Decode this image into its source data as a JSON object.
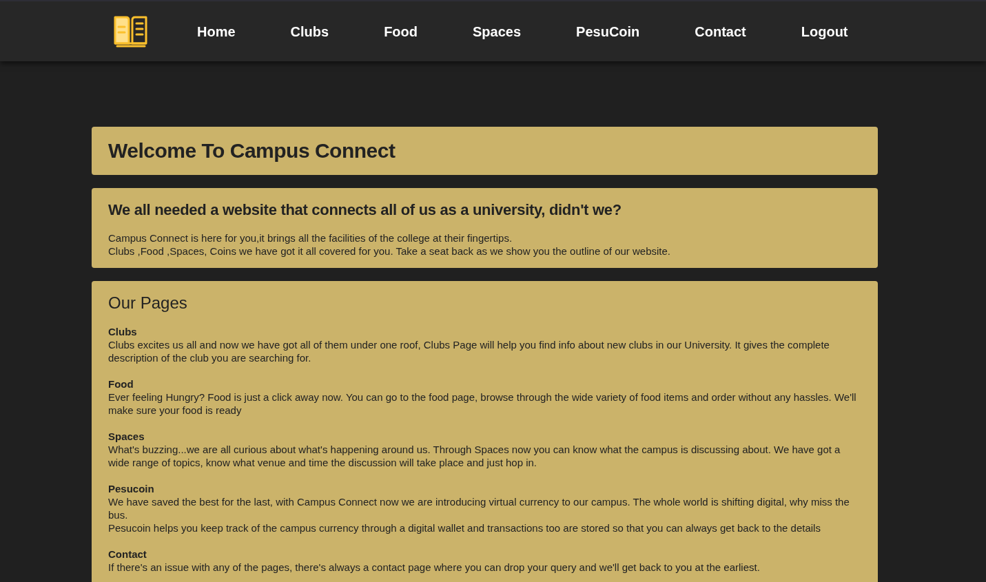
{
  "nav": {
    "items": [
      {
        "label": "Home"
      },
      {
        "label": "Clubs"
      },
      {
        "label": "Food"
      },
      {
        "label": "Spaces"
      },
      {
        "label": "PesuCoin"
      },
      {
        "label": "Contact"
      },
      {
        "label": "Logout"
      }
    ]
  },
  "welcome": {
    "title": "Welcome To Campus Connect"
  },
  "intro": {
    "heading": "We all needed a website that connects all of us as a university, didn't we?",
    "lines": [
      "Campus Connect is here for you,it brings all the facilities of the college at their fingertips.",
      "Clubs ,Food ,Spaces, Coins we have got it all covered for you. Take a seat back as we show you the outline of our website."
    ]
  },
  "pages": {
    "heading": "Our Pages",
    "sections": [
      {
        "title": "Clubs",
        "lines": [
          "Clubs excites us all and now we have got all of them under one roof, Clubs Page will help you find info about new clubs in our University. It gives the complete description of the club you are searching for."
        ]
      },
      {
        "title": "Food",
        "lines": [
          "Ever feeling Hungry? Food is just a click away now. You can go to the food page, browse through the wide variety of food items and order without any hassles. We'll make sure your food is ready"
        ]
      },
      {
        "title": "Spaces",
        "lines": [
          "What's buzzing...we are all curious about what's happening around us. Through Spaces now you can know what the campus is discussing about. We have got a wide range of topics, know what venue and time the discussion will take place and just hop in."
        ]
      },
      {
        "title": "Pesucoin",
        "lines": [
          "We have saved the best for the last, with Campus Connect now we are introducing virtual currency to our campus. The whole world is shifting digital, why miss the bus.",
          "Pesucoin helps you keep track of the campus currency through a digital wallet and transactions too are stored so that you can always get back to the details"
        ]
      },
      {
        "title": "Contact",
        "lines": [
          "If there's an issue with any of the pages, there's always a contact page where you can drop your query and we'll get back to you at the earliest."
        ]
      }
    ]
  }
}
